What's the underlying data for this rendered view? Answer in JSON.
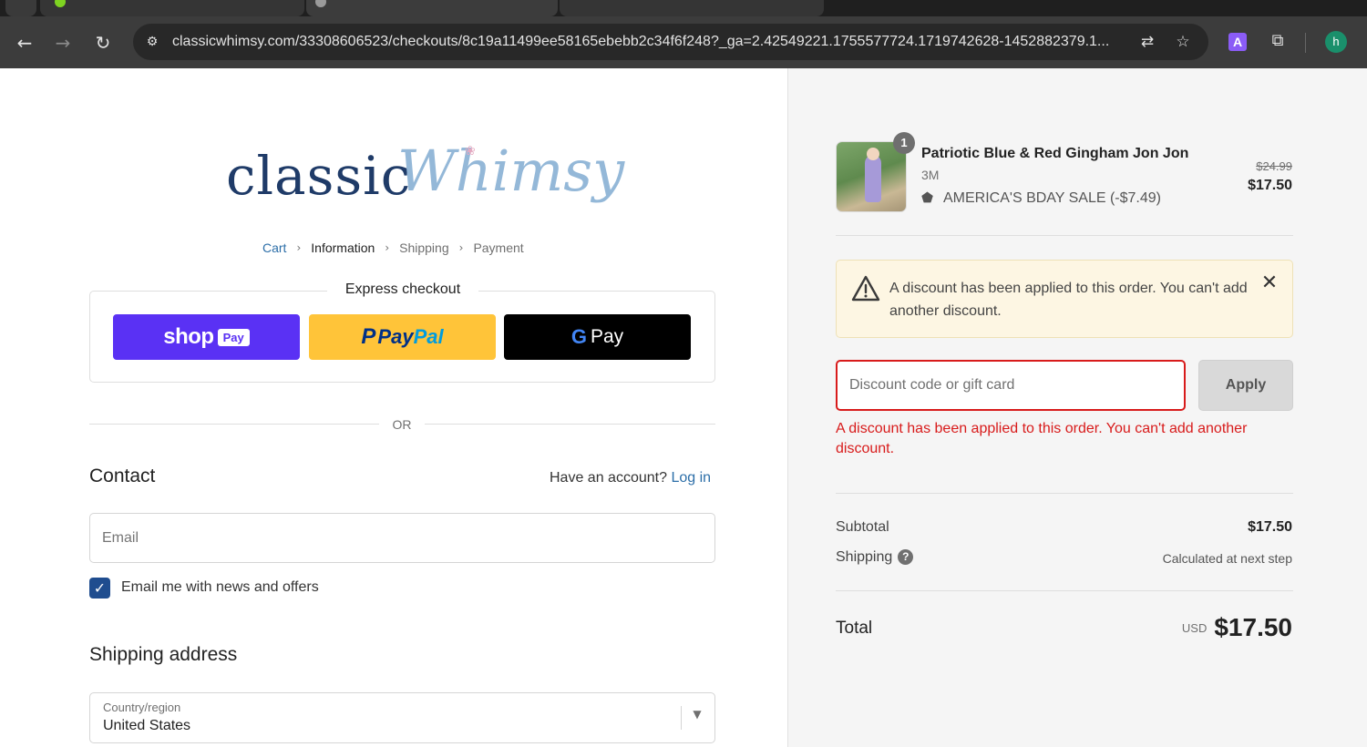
{
  "browser": {
    "url": "classicwhimsy.com/33308606523/checkouts/8c19a11499ee58165ebebb2c34f6f248?_ga=2.42549221.1755577724.1719742628-1452882379.1...",
    "icons": [
      "back-icon",
      "forward-icon",
      "reload-icon",
      "site-info-icon",
      "translate-icon",
      "bookmark-star-icon",
      "extension-a-icon",
      "extensions-puzzle-icon",
      "profile-avatar"
    ],
    "ext_label": "A",
    "profile_initial": "h"
  },
  "brand": {
    "word1": "classic",
    "word2": "Whimsy",
    "colors": {
      "navy": "#1f3b68",
      "light_blue": "#94b8d8"
    }
  },
  "breadcrumb": {
    "items": [
      "Cart",
      "Information",
      "Shipping",
      "Payment"
    ],
    "separator": "›"
  },
  "express": {
    "title": "Express checkout",
    "shop_word": "shop",
    "shop_pay": "Pay",
    "paypal_word1": "Pay",
    "paypal_word2": "Pal",
    "gpay_g": "G",
    "gpay_word": "Pay"
  },
  "or_text": "OR",
  "contact": {
    "title": "Contact",
    "have_account": "Have an account?",
    "login": "Log in",
    "email_placeholder": "Email",
    "newsletter_label": "Email me with news and offers",
    "newsletter_checked": true
  },
  "shipping_address": {
    "title": "Shipping address",
    "country_label": "Country/region",
    "country_value": "United States"
  },
  "summary": {
    "item": {
      "quantity": "1",
      "name": "Patriotic Blue & Red Gingham Jon Jon",
      "variant": "3M",
      "discount": "AMERICA'S BDAY SALE (-$7.49)",
      "original_price": "$24.99",
      "price": "$17.50"
    },
    "notice": "A discount has been applied to this order. You can't add another discount.",
    "discount_placeholder": "Discount code or gift card",
    "apply_label": "Apply",
    "error": "A discount has been applied to this order. You can't add another discount.",
    "subtotal_label": "Subtotal",
    "subtotal_value": "$17.50",
    "shipping_label": "Shipping",
    "shipping_value": "Calculated at next step",
    "total_label": "Total",
    "currency": "USD",
    "total_value": "$17.50"
  },
  "colors": {
    "accent_link": "#2c6ea8",
    "error": "#d81b1b",
    "shop_pay": "#5a31f4",
    "paypal": "#ffc439",
    "checkbox": "#1f4d8f"
  }
}
